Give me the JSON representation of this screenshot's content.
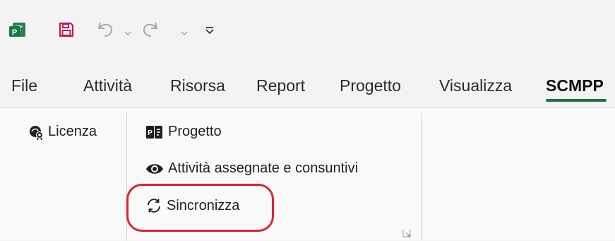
{
  "tabs": [
    {
      "label": "File",
      "active": false
    },
    {
      "label": "Attività",
      "active": false
    },
    {
      "label": "Risorsa",
      "active": false
    },
    {
      "label": "Report",
      "active": false
    },
    {
      "label": "Progetto",
      "active": false
    },
    {
      "label": "Visualizza",
      "active": false
    },
    {
      "label": "SCMPP",
      "active": true
    }
  ],
  "ribbon": {
    "license_label": "Licenza",
    "project_label": "Progetto",
    "assignments_label": "Attività assegnate e consuntivi",
    "sync_label": "Sincronizza"
  },
  "colors": {
    "accent": "#217346",
    "save_icon": "#c2185b",
    "highlight": "#e4222b"
  }
}
